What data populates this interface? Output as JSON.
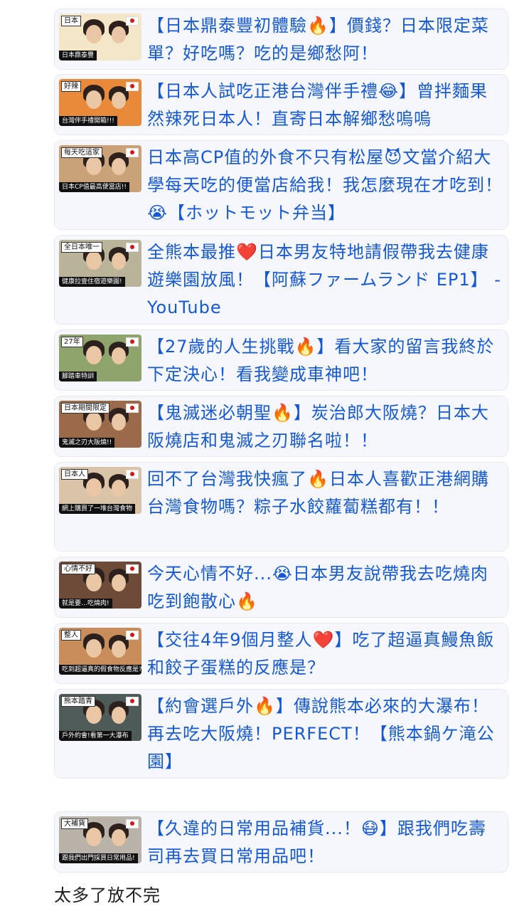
{
  "top_cut_text": "",
  "links": [
    {
      "title": "【日本鼎泰豐初體驗🔥】價錢？日本限定菜單？好吃嗎？吃的是鄉愁阿！",
      "thumb_caption": "日本鼎泰豐",
      "thumb_badge": "日本",
      "thumb_bg": "#f4e7c8"
    },
    {
      "title": "【日本人試吃正港台灣伴手禮😂】曾拌麵果然辣死日本人！直寄日本解鄉愁嗚嗚",
      "thumb_caption": "台灣伴手禮開箱!!!",
      "thumb_badge": "好辣",
      "thumb_bg": "#e98a3a"
    },
    {
      "title": "日本高CP值的外食不只有松屋😈文當介紹大學每天吃的便當店給我！我怎麼現在才吃到！😭【ホットモット弁当】",
      "thumb_caption": "日本CP值最高便當店!!",
      "thumb_badge": "每天吃這家",
      "thumb_bg": "#c9a27a"
    },
    {
      "title": "全熊本最推❤️日本男友特地請假帶我去健康遊樂園放風！【阿蘇ファームランド EP1】 - YouTube",
      "thumb_caption": "健康拉壹住宿遊樂園!",
      "thumb_badge": "全日本唯一",
      "thumb_bg": "#b9b39a"
    },
    {
      "title": "【27歲的人生挑戰🔥】看大家的留言我終於下定決心！看我變成車神吧！",
      "thumb_caption": "腳踏車特訓",
      "thumb_badge": "27年",
      "thumb_bg": "#8fa36d"
    },
    {
      "title": "【鬼滅迷必朝聖🔥】炭治郎大阪燒？日本大阪燒店和鬼滅之刃聯名啦！！",
      "thumb_caption": "鬼滅之刃大阪燒!!",
      "thumb_badge": "日本期間限定",
      "thumb_bg": "#9b6a4a"
    },
    {
      "title": "回不了台灣我快瘋了🔥日本人喜歡正港網購台灣食物嗎？粽子水餃蘿蔔糕都有！！",
      "thumb_caption": "網上購買了一堆台灣食物",
      "thumb_badge": "日本人",
      "thumb_bg": "#d9c4a8"
    },
    {
      "title": "今天心情不好...😭日本男友說帶我去吃燒肉吃到飽散心🔥",
      "thumb_caption": "就是要…吃燒肉!",
      "thumb_badge": "心情不好",
      "thumb_bg": "#6d4b38"
    },
    {
      "title": "【交往4年9個月整人❤️】吃了超逼真鰻魚飯和餃子蛋糕的反應是？",
      "thumb_caption": "吃到超逼真的假食物反應是?",
      "thumb_badge": "整人",
      "thumb_bg": "#c98d5c"
    },
    {
      "title": "【約會選戶外🔥】傳說熊本必來的大瀑布！再去吃大阪燒！PERFECT！【熊本鍋ケ滝公園】",
      "thumb_caption": "戶外約會!看第一大瀑布",
      "thumb_badge": "熊本踏青",
      "thumb_bg": "#4f5b58"
    },
    {
      "title": "【久違的日常用品補貨...！😷】跟我們吃壽司再去買日常用品吧！",
      "thumb_caption": "跟我們出門採買日常用品!",
      "thumb_badge": "大補貨",
      "thumb_bg": "#b8b2a8"
    }
  ],
  "footer_text": "太多了放不完"
}
